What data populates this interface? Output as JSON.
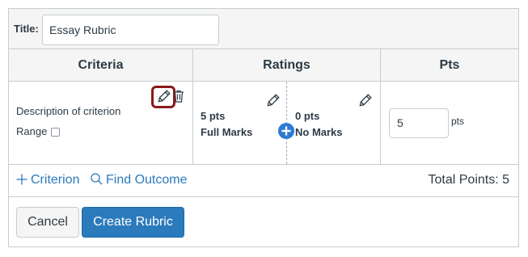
{
  "title_row": {
    "label": "Title:",
    "value": "Essay Rubric"
  },
  "headers": {
    "criteria": "Criteria",
    "ratings": "Ratings",
    "pts": "Pts"
  },
  "criterion": {
    "description": "Description of criterion",
    "range_label": "Range",
    "range_checked": false,
    "ratings": [
      {
        "points": "5 pts",
        "description": "Full Marks"
      },
      {
        "points": "0 pts",
        "description": "No Marks"
      }
    ],
    "points_value": "5",
    "points_unit": "pts"
  },
  "footer": {
    "add_criterion_label": "Criterion",
    "find_outcome_label": "Find Outcome",
    "total_points": "Total Points: 5"
  },
  "buttons": {
    "cancel": "Cancel",
    "create": "Create Rubric"
  },
  "icons": {
    "edit": "pencil-icon",
    "delete": "trash-icon",
    "add_rating": "plus-circle-icon",
    "add_criterion": "plus-icon",
    "find_outcome": "search-icon"
  },
  "colors": {
    "accent": "#2b7abc",
    "highlight": "#8b1a1a",
    "border": "#c7cdd1",
    "header_bg": "#f5f5f5",
    "text": "#2d3b45"
  }
}
